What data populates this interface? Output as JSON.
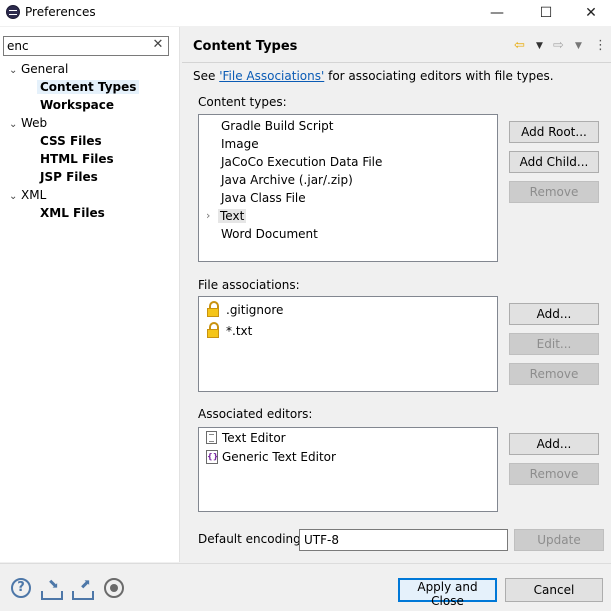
{
  "window": {
    "title": "Preferences",
    "minimize_glyph": "—",
    "maximize_glyph": "☐",
    "close_glyph": "✕"
  },
  "filter": {
    "value": "enc",
    "clear_glyph": "✕"
  },
  "tree": {
    "categories": [
      {
        "label": "General",
        "pages": [
          "Content Types",
          "Workspace"
        ]
      },
      {
        "label": "Web",
        "pages": [
          "CSS Files",
          "HTML Files",
          "JSP Files"
        ]
      },
      {
        "label": "XML",
        "pages": [
          "XML Files"
        ]
      }
    ],
    "selected_page": "Content Types"
  },
  "header": {
    "title": "Content Types",
    "back_icon": "arrow-left-icon",
    "forward_icon": "arrow-right-icon",
    "view_menu_icon": "vertical-dots-icon"
  },
  "description": {
    "prefix": "See ",
    "link": "'File Associations'",
    "suffix": " for associating editors with file types."
  },
  "content_types": {
    "label": "Content types:",
    "items": [
      "Gradle Build Script",
      "Image",
      "JaCoCo Execution Data File",
      "Java Archive (.jar/.zip)",
      "Java Class File",
      "Text",
      "Word Document"
    ],
    "expandable_item": "Text",
    "buttons": {
      "add_root": "Add Root...",
      "add_child": "Add Child...",
      "remove": "Remove"
    }
  },
  "file_associations": {
    "label": "File associations:",
    "items": [
      ".gitignore",
      "*.txt"
    ],
    "item_icon": "lock-icon",
    "buttons": {
      "add": "Add...",
      "edit": "Edit...",
      "remove": "Remove"
    }
  },
  "associated_editors": {
    "label": "Associated editors:",
    "items": [
      "Text Editor",
      "Generic Text Editor"
    ],
    "buttons": {
      "add": "Add...",
      "remove": "Remove"
    }
  },
  "encoding": {
    "label": "Default encoding:",
    "value": "UTF-8",
    "update_label": "Update"
  },
  "footer": {
    "apply_close_label": "Apply and Close",
    "cancel_label": "Cancel",
    "icons": [
      "help-icon",
      "import-icon",
      "export-icon",
      "record-icon"
    ]
  },
  "colors": {
    "link": "#0a5bb5",
    "selection": "#e5f1fb",
    "default_button_border": "#0078d7",
    "nav_back": "#e8a800"
  }
}
